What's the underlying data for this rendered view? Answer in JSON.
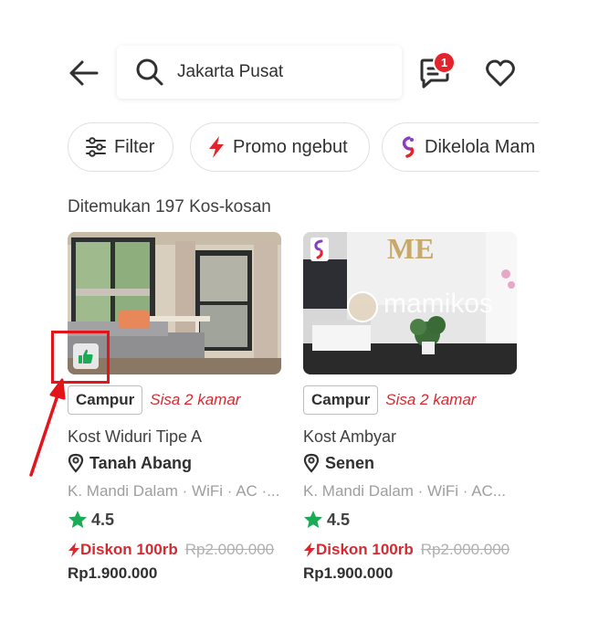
{
  "header": {
    "search": {
      "value": "Jakarta Pusat"
    },
    "chat": {
      "badge_count": "1"
    }
  },
  "chips": [
    {
      "label": "Filter",
      "icon": "sliders-icon"
    },
    {
      "label": "Promo ngebut",
      "icon": "lightning-icon"
    },
    {
      "label": "Dikelola Mam",
      "icon": "mamikos-logo-icon"
    }
  ],
  "results": {
    "count_text": "Ditemukan 197 Kos-kosan"
  },
  "cards": [
    {
      "tag": "Campur",
      "availability": "Sisa 2 kamar",
      "title": "Kost Widuri Tipe A",
      "location": "Tanah Abang",
      "facilities": "K. Mandi Dalam · WiFi · AC ·...",
      "rating": "4.5",
      "discount": "Diskon 100rb",
      "old_price": "Rp2.000.000",
      "price": "Rp1.900.000"
    },
    {
      "tag": "Campur",
      "availability": "Sisa 2 kamar",
      "title": "Kost Ambyar",
      "location": "Senen",
      "facilities": "K. Mandi Dalam · WiFi · AC...",
      "rating": "4.5",
      "discount": "Diskon 100rb",
      "old_price": "Rp2.000.000",
      "price": "Rp1.900.000",
      "watermark": "mamikos",
      "wall_sign": "ME"
    }
  ],
  "colors": {
    "accent_red": "#d9282f",
    "star_green": "#1baa56",
    "highlight": "#e3141a"
  }
}
